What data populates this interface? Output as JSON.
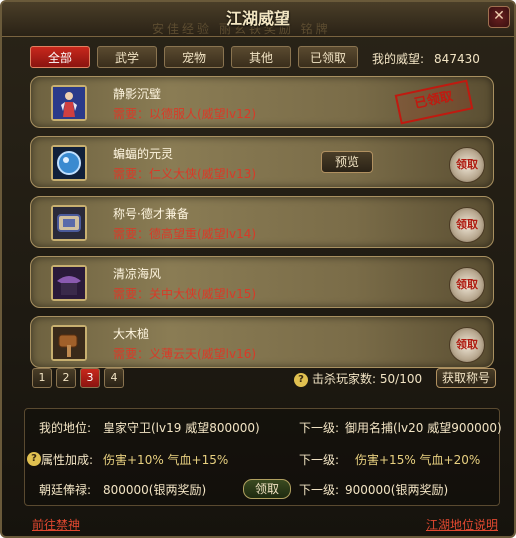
{
  "window": {
    "title": "江湖威望",
    "title_watermark": "安佳经验  丽玄铁奖励   铭牌",
    "close_label": "✕"
  },
  "tabs": [
    {
      "label": "全部",
      "active": true
    },
    {
      "label": "武学",
      "active": false
    },
    {
      "label": "宠物",
      "active": false
    },
    {
      "label": "其他",
      "active": false
    },
    {
      "label": "已领取",
      "active": false
    }
  ],
  "prestige": {
    "label": "我的威望:",
    "value": "847430"
  },
  "items": [
    {
      "name": "静影沉璧",
      "requirement": "需要：以德服人(威望lv12)",
      "status": "claimed",
      "status_label": "已领取",
      "icon": "figure-icon"
    },
    {
      "name": "蝙蝠的元灵",
      "requirement": "需要：仁义大侠(威望lv13)",
      "status": "claim",
      "status_label": "领取",
      "preview_label": "预览",
      "icon": "orb-icon"
    },
    {
      "name": "称号·德才兼备",
      "requirement": "需要：德高望重(威望lv14)",
      "status": "claim",
      "status_label": "领取",
      "icon": "scroll-icon"
    },
    {
      "name": "清凉海风",
      "requirement": "需要：关中大侠(威望lv15)",
      "status": "claim",
      "status_label": "领取",
      "icon": "hat-icon"
    },
    {
      "name": "大木槌",
      "requirement": "需要：义薄云天(威望lv16)",
      "status": "claim",
      "status_label": "领取",
      "icon": "mallet-icon"
    }
  ],
  "pagination": {
    "pages": [
      "1",
      "2",
      "3",
      "4"
    ],
    "active_index": 2
  },
  "kills": {
    "label": "击杀玩家数:",
    "value": "50/100"
  },
  "get_title_button": "获取称号",
  "status": {
    "my_rank_label": "我的地位:",
    "my_rank_value": "皇家守卫(lv19 威望800000)",
    "next_rank_label": "下一级:",
    "next_rank_value": "御用名捕(lv20 威望900000)",
    "attr_label": "属性加成:",
    "attr_value": "伤害+10% 气血+15%",
    "next_attr_label": "下一级:",
    "next_attr_value": "伤害+15% 气血+20%",
    "salary_label": "朝廷俸禄:",
    "salary_value": "800000(银两奖励)",
    "claim_button": "领取",
    "next_salary_label": "下一级:",
    "next_salary_value": "900000(银两奖励)"
  },
  "footer": {
    "left_link": "前往禁神",
    "right_link": "江湖地位说明"
  }
}
